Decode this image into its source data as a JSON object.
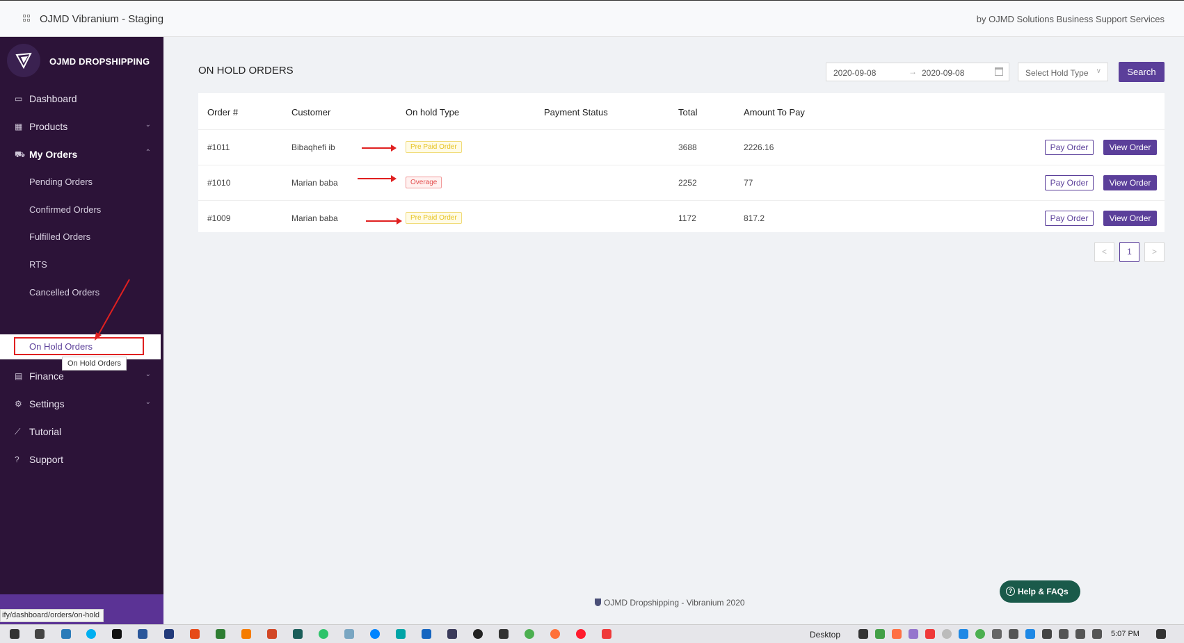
{
  "header": {
    "app_title": "OJMD Vibranium - Staging",
    "byline": "by OJMD Solutions Business Support Services"
  },
  "sidebar": {
    "brand_name": "OJMD DROPSHIPPING",
    "items": [
      {
        "label": "Dashboard",
        "icon": "monitor-icon"
      },
      {
        "label": "Products",
        "icon": "grid-icon"
      },
      {
        "label": "My Orders",
        "icon": "cart-icon"
      },
      {
        "label": "Finance",
        "icon": "wallet-icon"
      },
      {
        "label": "Settings",
        "icon": "gear-icon"
      },
      {
        "label": "Tutorial",
        "icon": "line-chart-icon"
      },
      {
        "label": "Support",
        "icon": "question-icon"
      }
    ],
    "sub_items": [
      {
        "label": "Pending Orders"
      },
      {
        "label": "Confirmed Orders"
      },
      {
        "label": "Fulfilled Orders"
      },
      {
        "label": "RTS"
      },
      {
        "label": "Cancelled Orders"
      },
      {
        "label": "On Hold Orders"
      }
    ],
    "tooltip": "On Hold Orders",
    "status_url": "ify/dashboard/orders/on-hold"
  },
  "main": {
    "title": "ON HOLD ORDERS",
    "date_from": "2020-09-08",
    "date_to": "2020-09-08",
    "hold_type_placeholder": "Select Hold Type",
    "search_label": "Search",
    "columns": [
      "Order #",
      "Customer",
      "On hold Type",
      "Payment Status",
      "Total",
      "Amount To Pay"
    ],
    "rows": [
      {
        "order": "#1011",
        "customer": "Bibaqhefi ib",
        "hold_type": "Pre Paid Order",
        "payment_status": "",
        "total": "3688",
        "amount": "2226.16"
      },
      {
        "order": "#1010",
        "customer": "Marian baba",
        "hold_type": "Overage",
        "payment_status": "",
        "total": "2252",
        "amount": "77"
      },
      {
        "order": "#1009",
        "customer": "Marian baba",
        "hold_type": "Pre Paid Order",
        "payment_status": "",
        "total": "1172",
        "amount": "817.2"
      }
    ],
    "pay_label": "Pay Order",
    "view_label": "View Order",
    "pagination": {
      "prev": "<",
      "current": "1",
      "next": ">"
    }
  },
  "footer": {
    "text": "OJMD Dropshipping - Vibranium 2020",
    "help_label": "Help & FAQs"
  },
  "taskbar": {
    "desktop_label": "Desktop",
    "time": "5:07 PM"
  },
  "colors": {
    "sidebar_bg": "#2c1338",
    "accent": "#5b3f9a",
    "prepaid_tag": "#e6c321",
    "overage_tag": "#e34c4c",
    "annotation_red": "#e02020",
    "help_button": "#1a5a4a"
  }
}
